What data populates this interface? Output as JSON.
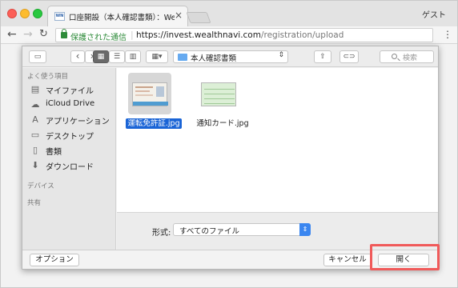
{
  "browser": {
    "tab": {
      "favicon": "WN",
      "title": "口座開設（本人確認書類）：Wealt",
      "close": "×"
    },
    "profile": "ゲスト",
    "nav": {
      "back": "←",
      "forward": "→",
      "reload": "↻",
      "menu": "⋮"
    },
    "address": {
      "secure_label": "保護された通信",
      "url_host": "https://invest.wealthnavi.com",
      "url_path": "/registration/upload"
    }
  },
  "dialog": {
    "toolbar": {
      "sidebar_toggle": "▭",
      "back": "‹",
      "forward": "›",
      "view_icon": "▦",
      "view_list": "☰",
      "view_columns": "▥",
      "view_gallery": "▦▾",
      "location": "本人確認書類",
      "share": "⇧",
      "tag": "⊂⊃",
      "search_placeholder": "検索"
    },
    "sidebar": {
      "favorites_header": "よく使う項目",
      "items": [
        {
          "label": "マイファイル",
          "icon": "▤"
        },
        {
          "label": "iCloud Drive",
          "icon": "☁"
        },
        {
          "label": "アプリケーション",
          "icon": "A"
        },
        {
          "label": "デスクトップ",
          "icon": "▭"
        },
        {
          "label": "書類",
          "icon": "▯"
        },
        {
          "label": "ダウンロード",
          "icon": "⬇"
        }
      ],
      "devices_header": "デバイス",
      "shared_header": "共有"
    },
    "files": [
      {
        "name": "運転免許証.jpg",
        "selected": true
      },
      {
        "name": "通知カード.jpg",
        "selected": false
      }
    ],
    "format": {
      "label": "形式:",
      "value": "すべてのファイル",
      "arrow": "⇕"
    },
    "buttons": {
      "options": "オプション",
      "cancel": "キャンセル",
      "open": "開く"
    }
  }
}
